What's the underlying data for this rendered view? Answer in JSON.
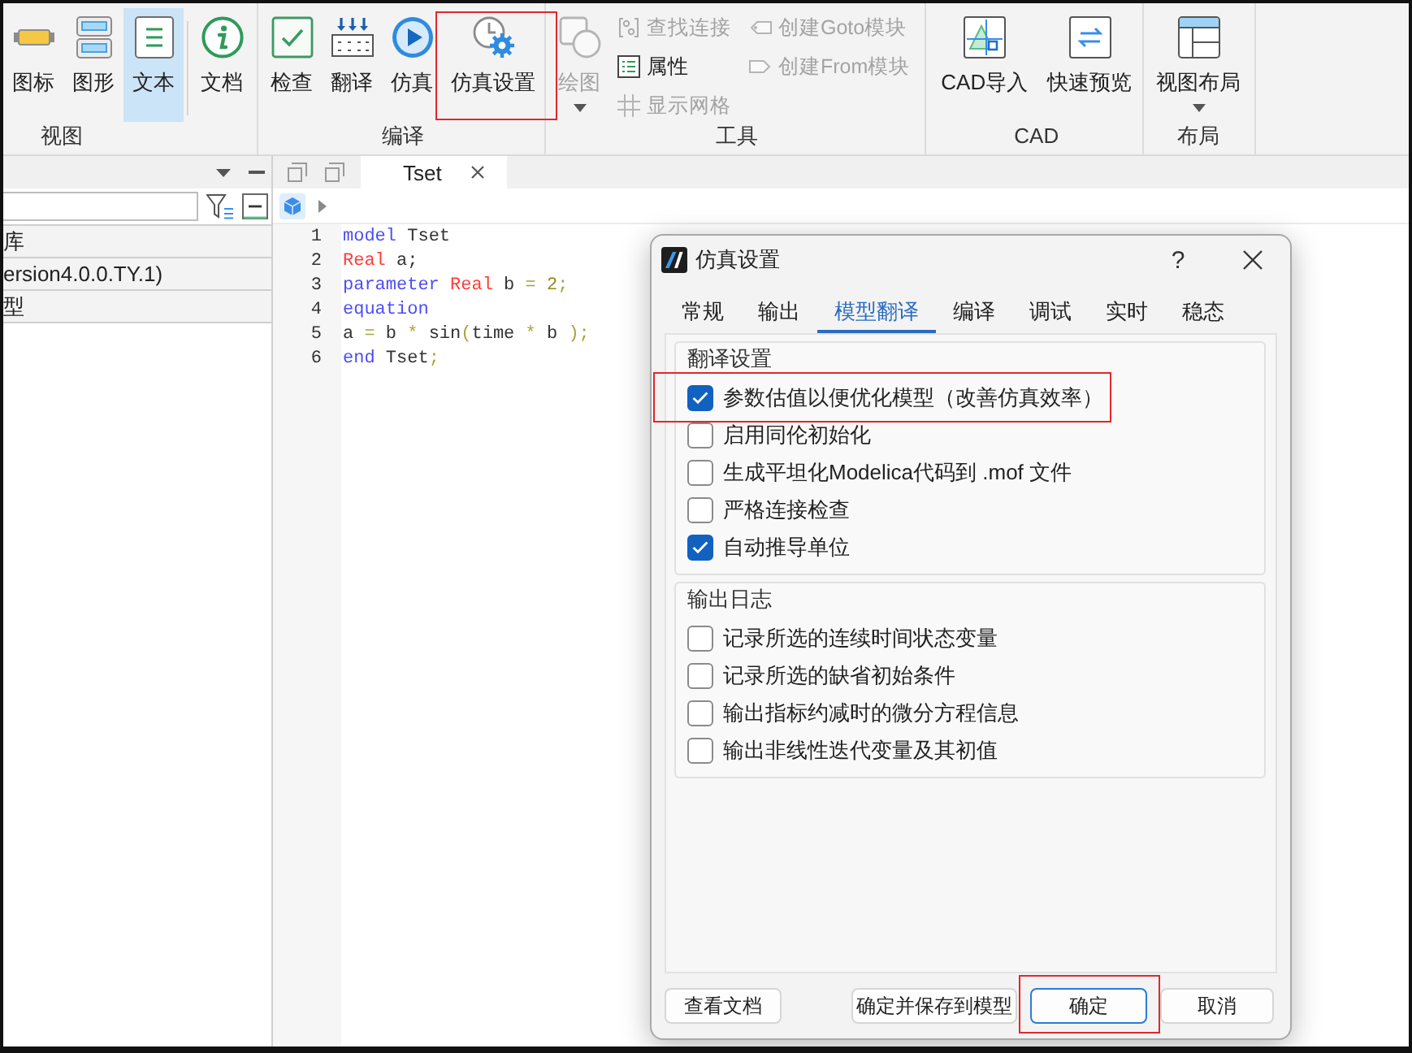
{
  "ribbon": {
    "groups": [
      {
        "label": "视图",
        "items": [
          {
            "label": "图标",
            "kind": "large",
            "selected": false
          },
          {
            "label": "图形",
            "kind": "large",
            "selected": false
          },
          {
            "label": "文本",
            "kind": "large",
            "selected": true
          },
          {
            "label": "文档",
            "kind": "large",
            "selected": false,
            "separator_before": true
          }
        ]
      },
      {
        "label": "编译",
        "items": [
          {
            "label": "检查",
            "kind": "large",
            "highlighted": false
          },
          {
            "label": "翻译",
            "kind": "large",
            "highlighted": false
          },
          {
            "label": "仿真",
            "kind": "large",
            "highlighted": false
          },
          {
            "label": "仿真设置",
            "kind": "large",
            "highlighted": true
          }
        ]
      },
      {
        "label": "工具",
        "items": [
          {
            "label": "绘图",
            "kind": "large",
            "disabled": true,
            "dropdown": true
          },
          {
            "label": "查找连接",
            "kind": "small",
            "disabled": true
          },
          {
            "label": "属性",
            "kind": "small",
            "disabled": false
          },
          {
            "label": "显示网格",
            "kind": "small",
            "disabled": true
          },
          {
            "label": "创建Goto模块",
            "kind": "small",
            "disabled": true
          },
          {
            "label": "创建From模块",
            "kind": "small",
            "disabled": true
          }
        ]
      },
      {
        "label": "CAD",
        "items": [
          {
            "label": "CAD导入",
            "kind": "large"
          },
          {
            "label": "快速预览",
            "kind": "large"
          }
        ]
      },
      {
        "label": "布局",
        "items": [
          {
            "label": "视图布局",
            "kind": "large",
            "dropdown": true
          }
        ]
      }
    ]
  },
  "library_panel": {
    "items": [
      {
        "label": "库"
      },
      {
        "label": "ersion4.0.0.TY.1)"
      },
      {
        "label": "型"
      }
    ]
  },
  "editor": {
    "tabs": [
      {
        "label": "Tset",
        "selected": true
      }
    ],
    "lines": [
      {
        "number": "1",
        "tokens": [
          {
            "text": "model",
            "kind": "keyword"
          },
          {
            "text": " Tset",
            "kind": "plain"
          }
        ]
      },
      {
        "number": "2",
        "tokens": [
          {
            "text": "Real",
            "kind": "type"
          },
          {
            "text": " a;",
            "kind": "plain"
          }
        ]
      },
      {
        "number": "3",
        "tokens": [
          {
            "text": "parameter",
            "kind": "keyword"
          },
          {
            "text": " Real",
            "kind": "type"
          },
          {
            "text": " b ",
            "kind": "plain"
          },
          {
            "text": "=",
            "kind": "op"
          },
          {
            "text": " 2",
            "kind": "number"
          },
          {
            "text": ";",
            "kind": "op"
          }
        ]
      },
      {
        "number": "4",
        "tokens": [
          {
            "text": "equation",
            "kind": "keyword"
          }
        ]
      },
      {
        "number": "5",
        "tokens": [
          {
            "text": "a ",
            "kind": "plain"
          },
          {
            "text": "=",
            "kind": "op"
          },
          {
            "text": " b ",
            "kind": "plain"
          },
          {
            "text": "*",
            "kind": "op"
          },
          {
            "text": " sin",
            "kind": "plain"
          },
          {
            "text": "(",
            "kind": "op"
          },
          {
            "text": "time ",
            "kind": "plain"
          },
          {
            "text": "*",
            "kind": "op"
          },
          {
            "text": " b ",
            "kind": "plain"
          },
          {
            "text": ");",
            "kind": "op"
          }
        ]
      },
      {
        "number": "6",
        "tokens": [
          {
            "text": "end",
            "kind": "keyword"
          },
          {
            "text": " Tset",
            "kind": "plain"
          },
          {
            "text": ";",
            "kind": "op"
          }
        ]
      }
    ]
  },
  "dialog": {
    "title": "仿真设置",
    "help_label": "?",
    "tabs": [
      {
        "label": "常规",
        "selected": false
      },
      {
        "label": "输出",
        "selected": false
      },
      {
        "label": "模型翻译",
        "selected": true
      },
      {
        "label": "编译",
        "selected": false
      },
      {
        "label": "调试",
        "selected": false
      },
      {
        "label": "实时",
        "selected": false
      },
      {
        "label": "稳态",
        "selected": false
      }
    ],
    "groups": [
      {
        "title": "翻译设置",
        "options": [
          {
            "label": "参数估值以便优化模型（改善仿真效率）",
            "checked": true,
            "highlighted": true
          },
          {
            "label": "启用同伦初始化",
            "checked": false,
            "highlighted": false
          },
          {
            "label": "生成平坦化Modelica代码到 .mof 文件",
            "checked": false,
            "highlighted": false
          },
          {
            "label": "严格连接检查",
            "checked": false,
            "highlighted": false
          },
          {
            "label": "自动推导单位",
            "checked": true,
            "highlighted": false
          }
        ]
      },
      {
        "title": "输出日志",
        "options": [
          {
            "label": "记录所选的连续时间状态变量",
            "checked": false,
            "highlighted": false
          },
          {
            "label": "记录所选的缺省初始条件",
            "checked": false,
            "highlighted": false
          },
          {
            "label": "输出指标约减时的微分方程信息",
            "checked": false,
            "highlighted": false
          },
          {
            "label": "输出非线性迭代变量及其初值",
            "checked": false,
            "highlighted": false
          }
        ]
      }
    ],
    "buttons": [
      {
        "label": "查看文档",
        "focused": false,
        "highlighted": false
      },
      {
        "label": "确定并保存到模型",
        "focused": false,
        "highlighted": false
      },
      {
        "label": "确定",
        "focused": true,
        "highlighted": true
      },
      {
        "label": "取消",
        "focused": false,
        "highlighted": false
      }
    ]
  }
}
